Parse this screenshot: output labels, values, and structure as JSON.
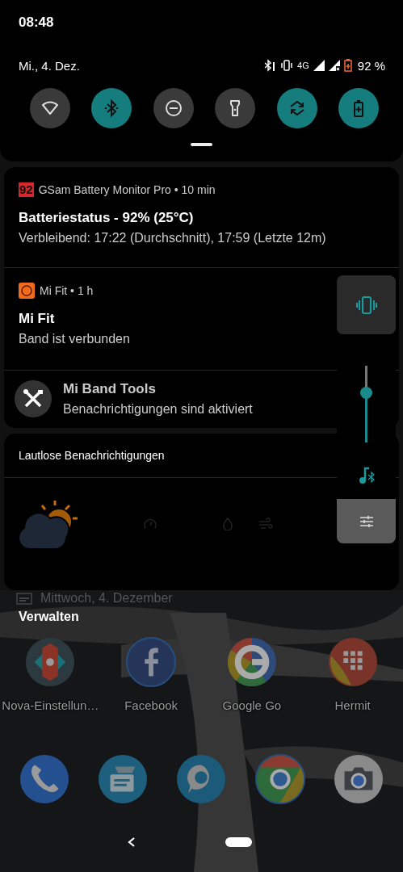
{
  "status_bar": {
    "time": "08:48"
  },
  "quick_settings": {
    "date": "Mi., 4. Dez.",
    "network": "4G",
    "battery": "92 %",
    "tiles": [
      {
        "kind": "wifi",
        "on": false
      },
      {
        "kind": "bluetooth",
        "on": true
      },
      {
        "kind": "dnd",
        "on": false
      },
      {
        "kind": "flashlight",
        "on": false
      },
      {
        "kind": "rotate",
        "on": true
      },
      {
        "kind": "battery",
        "on": true
      }
    ]
  },
  "notifications": [
    {
      "kind": "app",
      "badge": "92",
      "header": "GSam Battery Monitor Pro • 10 min",
      "title": "Batteriestatus - 92% (25°C)",
      "text": "Verbleibend: 17:22 (Durchschnitt), 17:59 (Letzte 12m)"
    },
    {
      "kind": "app",
      "header": "Mi Fit • 1 h",
      "title": "Mi Fit",
      "text": "Band ist verbunden"
    },
    {
      "kind": "service",
      "title": "Mi Band Tools",
      "text": "Benachrichtigungen sind aktiviert"
    }
  ],
  "silent_section": {
    "title": "Lautlose Benachrichtigungen"
  },
  "volume_panel": {
    "level": 0.64
  },
  "home": {
    "widget_date": "Mittwoch, 4. Dezember",
    "manage_button": "Verwalten",
    "apps": [
      {
        "label": "Nova-Einstellun…"
      },
      {
        "label": "Facebook"
      },
      {
        "label": "Google Go"
      },
      {
        "label": "Hermit"
      }
    ]
  }
}
